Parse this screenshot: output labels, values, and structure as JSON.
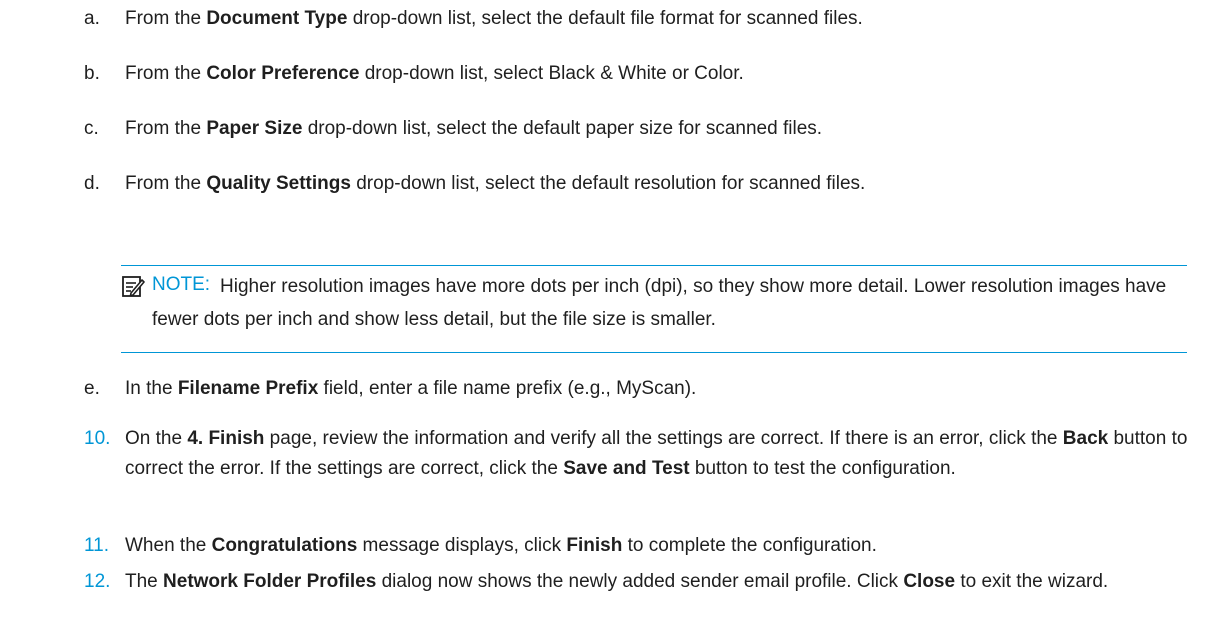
{
  "sub_steps": [
    {
      "marker": "a.",
      "before": "From the ",
      "keyword": "Document Type",
      "after": " drop-down list, select the default file format for scanned files."
    },
    {
      "marker": "b.",
      "before": "From the ",
      "keyword": "Color Preference",
      "after": " drop-down list, select Black & White or Color."
    },
    {
      "marker": "c.",
      "before": "From the ",
      "keyword": "Paper Size",
      "after": " drop-down list, select the default paper size for scanned files."
    },
    {
      "marker": "d.",
      "before": "From the ",
      "keyword": "Quality Settings",
      "after": " drop-down list, select the default resolution for scanned files."
    }
  ],
  "note": {
    "icon": "note-icon",
    "label": "NOTE:",
    "text": "Higher resolution images have more dots per inch (dpi), so they show more detail. Lower resolution images have fewer dots per inch and show less detail, but the file size is smaller."
  },
  "sub_step_e": {
    "marker": "e.",
    "before": "In the ",
    "keyword": "Filename Prefix",
    "after": " field, enter a file name prefix (e.g., MyScan)."
  },
  "steps": [
    {
      "number": "10.",
      "p1": "On the ",
      "k1": "4. Finish",
      "p2": " page, review the information and verify all the settings are correct. If there is an error, click the ",
      "k2": "Back",
      "p3": " button to correct the error. If the settings are correct, click the ",
      "k3": "Save and Test",
      "p4": " button to test the configuration."
    },
    {
      "number": "11.",
      "p1": "When the ",
      "k1": "Congratulations",
      "p2": " message displays, click ",
      "k2": "Finish",
      "p3": " to complete the configuration."
    },
    {
      "number": "12.",
      "p1": "The ",
      "k1": "Network Folder Profiles",
      "p2": " dialog now shows the newly added sender email profile. Click ",
      "k2": "Close",
      "p3": " to exit the wizard."
    }
  ],
  "colors": {
    "accent": "#0096d6",
    "text": "#1f1f1f"
  }
}
